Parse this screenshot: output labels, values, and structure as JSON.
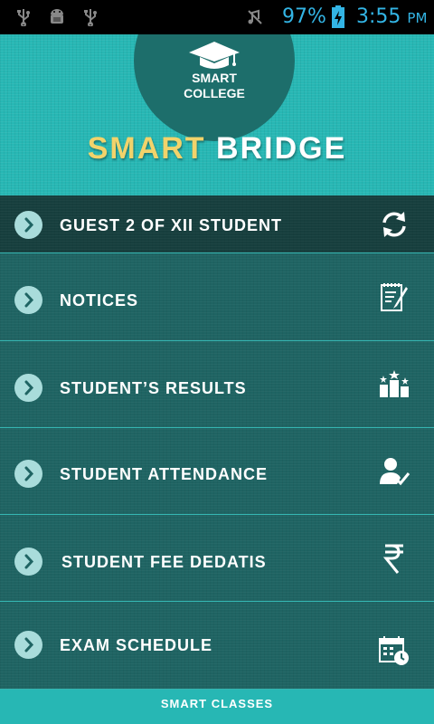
{
  "status_bar": {
    "battery": "97%",
    "time": "3:55",
    "ampm": "PM",
    "icons": [
      "usb-icon",
      "android-debug-icon",
      "usb-icon",
      "mute-icon",
      "battery-charging-icon"
    ]
  },
  "header": {
    "logo_line1": "SMART",
    "logo_line2": "COLLEGE",
    "title_part1": "SMART",
    "title_part2": "BRIDGE",
    "accent_color": "#f2d36b",
    "background_color": "#27b7b4"
  },
  "menu": {
    "items": [
      {
        "label": "GUEST 2 OF XII STUDENT",
        "icon": "refresh-icon"
      },
      {
        "label": "NOTICES",
        "icon": "notepad-pen-icon"
      },
      {
        "label": "STUDENT’S RESULTS",
        "icon": "podium-stars-icon"
      },
      {
        "label": "STUDENT ATTENDANCE",
        "icon": "user-check-icon"
      },
      {
        "label": "STUDENT FEE DEDATIS",
        "icon": "rupee-icon"
      },
      {
        "label": "EXAM SCHEDULE",
        "icon": "calendar-clock-icon"
      }
    ]
  },
  "footer": {
    "label": "SMART CLASSES"
  }
}
